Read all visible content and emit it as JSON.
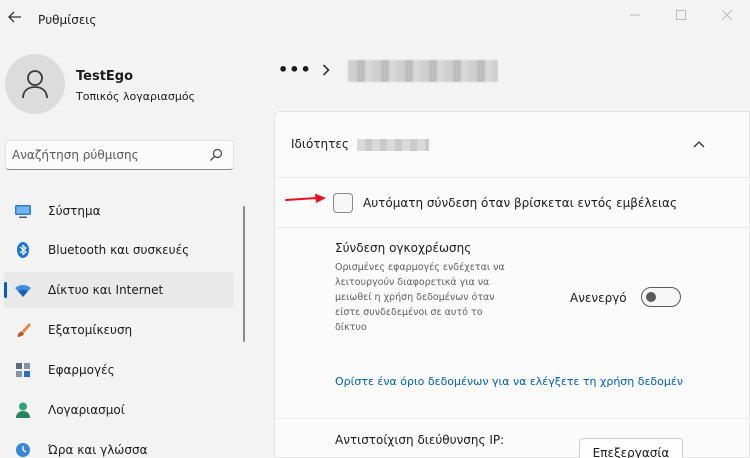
{
  "window": {
    "title": "Ρυθμίσεις"
  },
  "profile": {
    "name": "TestEgo",
    "account_type": "Τοπικός λογαριασμός"
  },
  "search": {
    "placeholder": "Αναζήτηση ρύθμισης",
    "value": ""
  },
  "sidebar": {
    "items": [
      {
        "label": "Σύστημα",
        "icon": "monitor-icon",
        "active": false
      },
      {
        "label": "Bluetooth και συσκευές",
        "icon": "bluetooth-icon",
        "active": false
      },
      {
        "label": "Δίκτυο και Internet",
        "icon": "wifi-icon",
        "active": true
      },
      {
        "label": "Εξατομίκευση",
        "icon": "brush-icon",
        "active": false
      },
      {
        "label": "Εφαρμογές",
        "icon": "apps-icon",
        "active": false
      },
      {
        "label": "Λογαριασμοί",
        "icon": "person-icon",
        "active": false
      },
      {
        "label": "Ώρα και γλώσσα",
        "icon": "globe-clock-icon",
        "active": false
      }
    ]
  },
  "breadcrumb": {
    "more": "•••"
  },
  "properties": {
    "title": "Ιδιότητες",
    "auto_connect_label": "Αυτόματη σύνδεση όταν βρίσκεται εντός εμβέλειας",
    "auto_connect_checked": false,
    "metered": {
      "title": "Σύνδεση ογκοχρέωσης",
      "description": "Ορισμένες εφαρμογές ενδέχεται να λειτουργούν διαφορετικά για να μειωθεί η χρήση δεδομένων όταν είστε συνδεδεμένοι σε αυτό το δίκτυο",
      "toggle_label": "Ανενεργό",
      "toggle_on": false
    },
    "data_limit_link": "Ορίστε ένα όριο δεδομένων για να ελέγξετε τη χρήση δεδομένων σε αυτό το δίκτυο",
    "ip": {
      "label": "Αντιστοίχιση διεύθυνσης IP:",
      "edit_label": "Επεξεργασία"
    }
  },
  "colors": {
    "accent": "#005fb8",
    "annotation_arrow": "#e81123"
  }
}
